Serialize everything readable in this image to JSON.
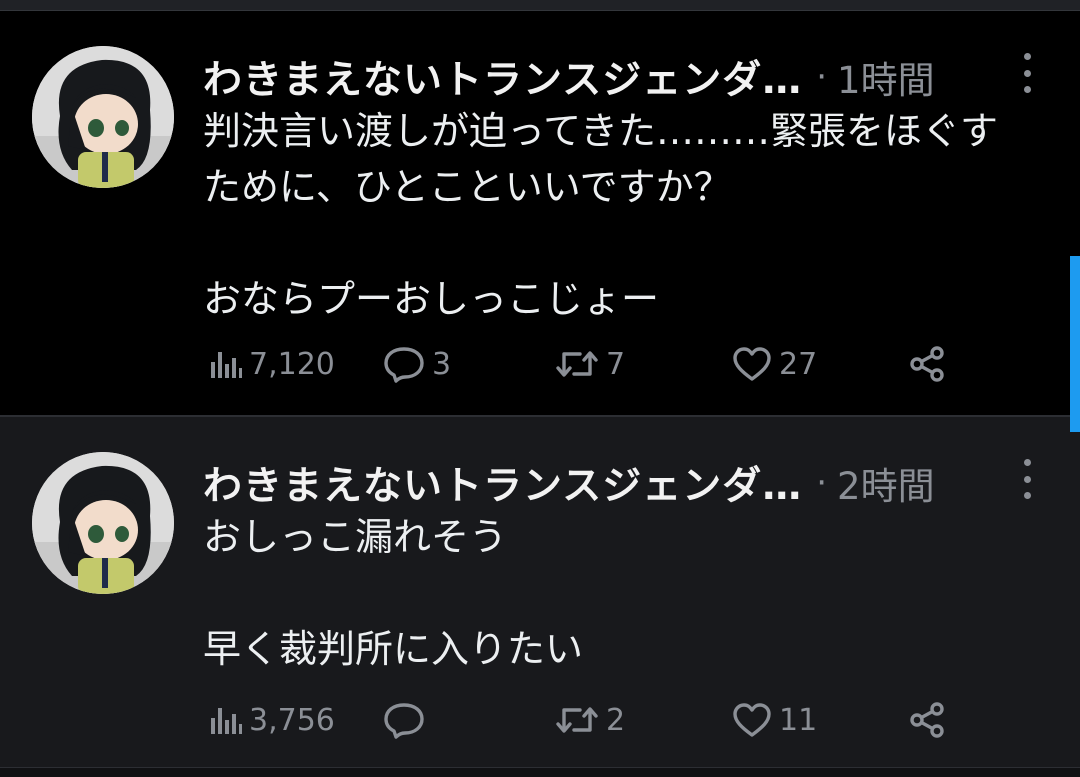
{
  "tweets": [
    {
      "author": "わきまえないトランスジェンダ…",
      "separator": "·",
      "time": "1時間",
      "lines": [
        "判決言い渡しが迫ってきた………緊張をほぐす",
        "ために、ひとこといいですか？",
        "",
        "おならプーおしっこじょー"
      ],
      "stats": {
        "views": "7,120",
        "replies": "3",
        "retweets": "7",
        "likes": "27"
      }
    },
    {
      "author": "わきまえないトランスジェンダ…",
      "separator": "·",
      "time": "2時間",
      "lines": [
        "おしっこ漏れそう",
        "",
        "早く裁判所に入りたい"
      ],
      "stats": {
        "views": "3,756",
        "replies": "",
        "retweets": "2",
        "likes": "11"
      }
    }
  ],
  "icons": {
    "views": "bar-chart-icon",
    "reply": "speech-bubble-icon",
    "retweet": "retweet-icon",
    "like": "heart-icon",
    "share": "share-icon",
    "more": "vertical-dots-icon"
  },
  "colors": {
    "background_top": "#000000",
    "background_bottom": "#18191c",
    "text": "#eceff1",
    "muted": "#8b8f96",
    "accent": "#1d9bf0"
  }
}
